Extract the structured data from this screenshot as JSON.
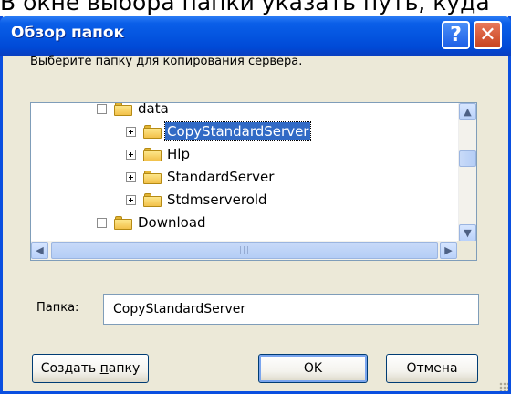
{
  "background": {
    "caption": "В окне выбора папки указать путь, куда"
  },
  "window": {
    "title": "Обзор папок",
    "help_label": "?",
    "close_label": "✕",
    "accent": "#0a4fe0"
  },
  "prompt": "Выберите папку для копирования сервера.",
  "tree": {
    "parent": {
      "label": "data",
      "state": "expanded"
    },
    "children": [
      {
        "label": "CopyStandardServer",
        "selected": true
      },
      {
        "label": "Hlp",
        "selected": false
      },
      {
        "label": "StandardServer",
        "selected": false
      },
      {
        "label": "Stdmserverold",
        "selected": false
      }
    ],
    "partial_next": {
      "label": "Download"
    },
    "selection_color": "#316ac5"
  },
  "folder_field": {
    "label": "Папка:",
    "value": "CopyStandardServer"
  },
  "buttons": {
    "new_folder_prefix": "Создать ",
    "new_folder_underlined": "п",
    "new_folder_suffix": "апку",
    "ok": "OK",
    "cancel": "Отмена"
  }
}
